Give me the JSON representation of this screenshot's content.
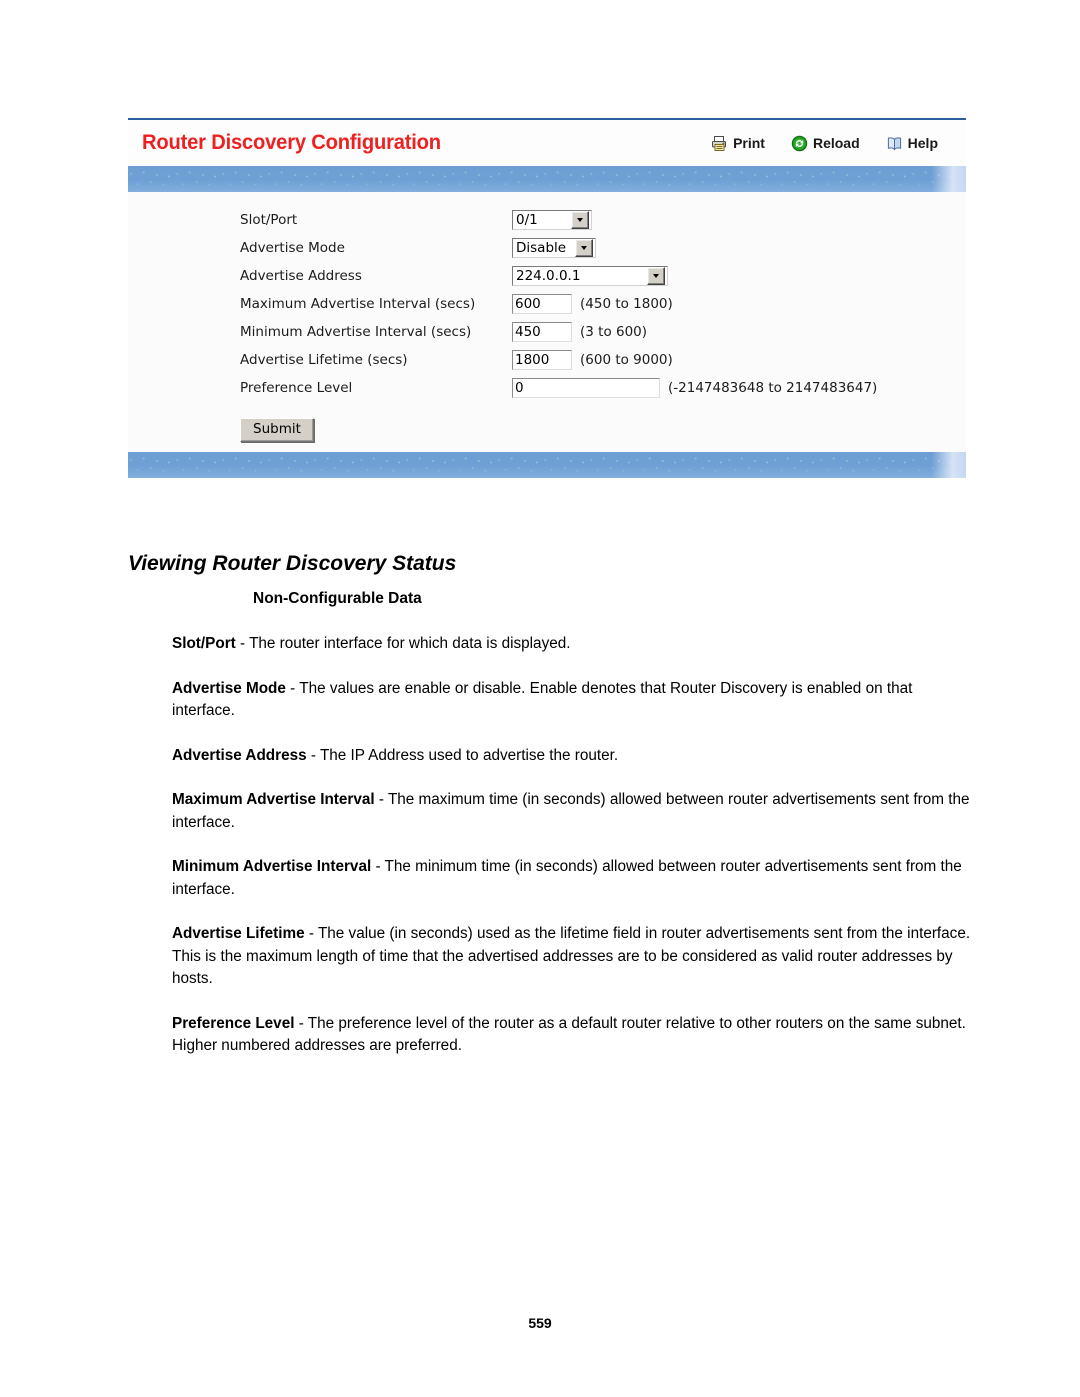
{
  "panel": {
    "title": "Router Discovery Configuration",
    "toolbar": {
      "print": "Print",
      "reload": "Reload",
      "help": "Help"
    },
    "form": {
      "rows": [
        {
          "label": "Slot/Port",
          "control": "select",
          "value": "0/1",
          "hint": ""
        },
        {
          "label": "Advertise Mode",
          "control": "select",
          "value": "Disable",
          "hint": ""
        },
        {
          "label": "Advertise Address",
          "control": "select",
          "value": "224.0.0.1",
          "hint": ""
        },
        {
          "label": "Maximum Advertise Interval (secs)",
          "control": "text",
          "value": "600",
          "hint": "(450 to 1800)"
        },
        {
          "label": "Minimum Advertise Interval (secs)",
          "control": "text",
          "value": "450",
          "hint": "(3 to 600)"
        },
        {
          "label": "Advertise Lifetime (secs)",
          "control": "text",
          "value": "1800",
          "hint": "(600 to 9000)"
        },
        {
          "label": "Preference Level",
          "control": "text",
          "value": "0",
          "hint": "(-2147483648 to 2147483647)"
        }
      ],
      "submit_label": "Submit"
    },
    "colors": {
      "title_red": "#ee2020",
      "band_blue": "#6e9fd4",
      "border_blue": "#2a5e9e"
    }
  },
  "document": {
    "section_heading": "Viewing Router Discovery Status",
    "sub_heading": "Non-Configurable Data",
    "paragraphs": [
      {
        "term": "Slot/Port",
        "sep": " - ",
        "text": "The router interface for which data is displayed."
      },
      {
        "term": "Advertise Mode",
        "sep": " - ",
        "text": "The values are enable or disable. Enable denotes that Router Discovery is enabled on that interface."
      },
      {
        "term": "Advertise Address",
        "sep": " - ",
        "text": "The IP Address used to advertise the router."
      },
      {
        "term": "Maximum Advertise Interval",
        "sep": " - ",
        "text": "The maximum time (in seconds) allowed between router advertisements sent from the interface."
      },
      {
        "term": "Minimum Advertise Interval",
        "sep": " - ",
        "text": "The minimum time (in seconds) allowed between router advertisements sent from the interface."
      },
      {
        "term": "Advertise Lifetime",
        "sep": " - ",
        "text": "The value (in seconds) used as the lifetime field in router advertisements sent from the interface. This is the maximum length of time that the advertised addresses are to be considered as valid router addresses by hosts."
      },
      {
        "term": "Preference Level",
        "sep": " - ",
        "text": "The preference level of the router as a default router relative to other routers on the same subnet. Higher numbered addresses are preferred."
      }
    ],
    "page_number": "559"
  }
}
